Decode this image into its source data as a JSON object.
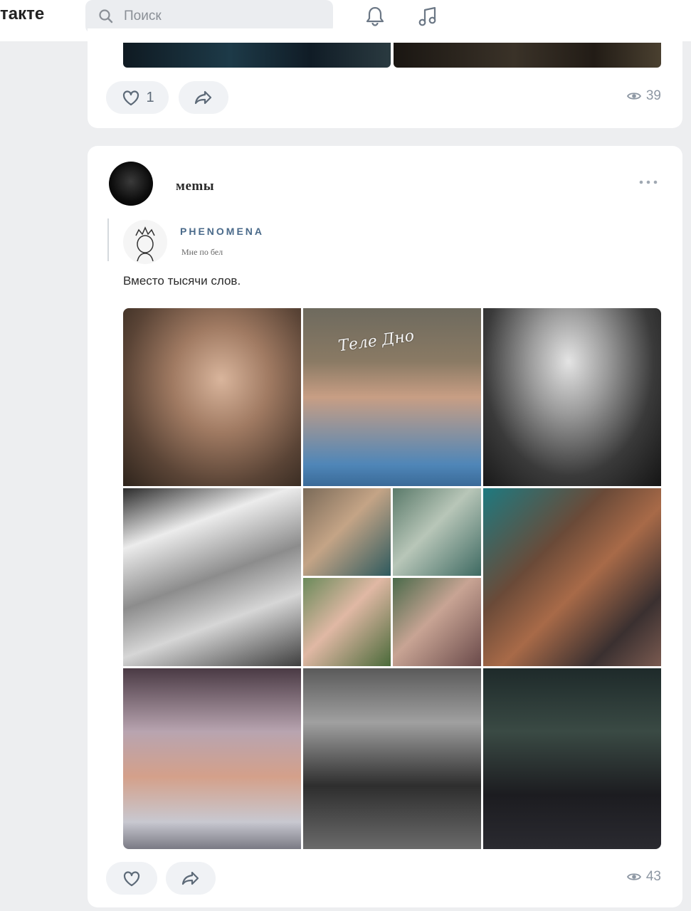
{
  "header": {
    "brand": "такте",
    "search_placeholder": "Поиск"
  },
  "icons": {
    "search": "search-icon",
    "bell": "bell-icon",
    "music": "music-note-icon",
    "heart": "heart-icon",
    "share": "share-arrow-icon",
    "eye": "eye-icon",
    "more": "more-dots-icon"
  },
  "post_prev": {
    "likes": "1",
    "views": "39"
  },
  "post": {
    "author": "мemы",
    "repost": {
      "name": "PHENOMENA",
      "sub": "Мне по бел"
    },
    "text": "Вместо тысячи слов.",
    "watermark": "Теле Дно",
    "views": "43"
  },
  "colors": {
    "page_bg": "#edeef0",
    "card_bg": "#ffffff",
    "button_bg": "#f0f2f5",
    "icon": "#5d6a78"
  }
}
